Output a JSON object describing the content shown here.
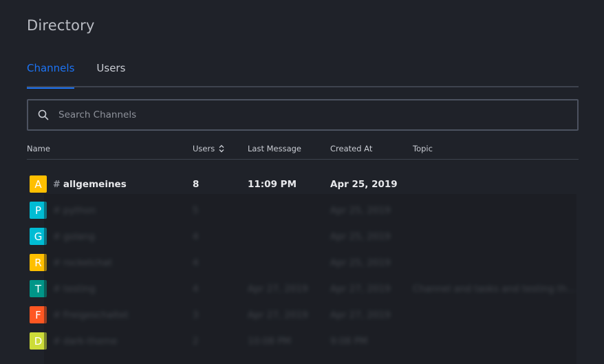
{
  "page": {
    "title": "Directory"
  },
  "tabs": [
    {
      "label": "Channels",
      "active": true
    },
    {
      "label": "Users",
      "active": false
    }
  ],
  "search": {
    "placeholder": "Search Channels",
    "value": ""
  },
  "table": {
    "columns": {
      "name": "Name",
      "users": "Users",
      "last_message": "Last Message",
      "created_at": "Created At",
      "topic": "Topic"
    },
    "rows": [
      {
        "avatar_letter": "A",
        "avatar_color": "#ffbf00",
        "name": "allgemeines",
        "users": "8",
        "last_message": "11:09 PM",
        "created_at": "Apr 25, 2019",
        "topic": ""
      },
      {
        "avatar_letter": "P",
        "avatar_color": "#00bcd4",
        "name": "python",
        "users": "5",
        "last_message": "",
        "created_at": "Apr 25, 2019",
        "topic": ""
      },
      {
        "avatar_letter": "G",
        "avatar_color": "#00bcd4",
        "name": "golang",
        "users": "4",
        "last_message": "",
        "created_at": "Apr 25, 2019",
        "topic": ""
      },
      {
        "avatar_letter": "R",
        "avatar_color": "#ffbf00",
        "name": "rocketchat",
        "users": "4",
        "last_message": "",
        "created_at": "Apr 25, 2019",
        "topic": ""
      },
      {
        "avatar_letter": "T",
        "avatar_color": "#009688",
        "name": "testing",
        "users": "4",
        "last_message": "Apr 27, 2019",
        "created_at": "Apr 27, 2019",
        "topic": "Channel and tasks and testing things"
      },
      {
        "avatar_letter": "F",
        "avatar_color": "#ff5722",
        "name": "Freigeschaltet",
        "users": "3",
        "last_message": "Apr 27, 2019",
        "created_at": "Apr 27, 2019",
        "topic": ""
      },
      {
        "avatar_letter": "D",
        "avatar_color": "#cddc39",
        "name": "dark-theme",
        "users": "2",
        "last_message": "10:08 PM",
        "created_at": "9:08 PM",
        "topic": ""
      }
    ]
  },
  "icons": {
    "search": "search-icon",
    "sort": "sort-arrows-icon",
    "hash": "hash-icon"
  },
  "colors": {
    "accent": "#1d74f5",
    "background": "#1f2229"
  }
}
